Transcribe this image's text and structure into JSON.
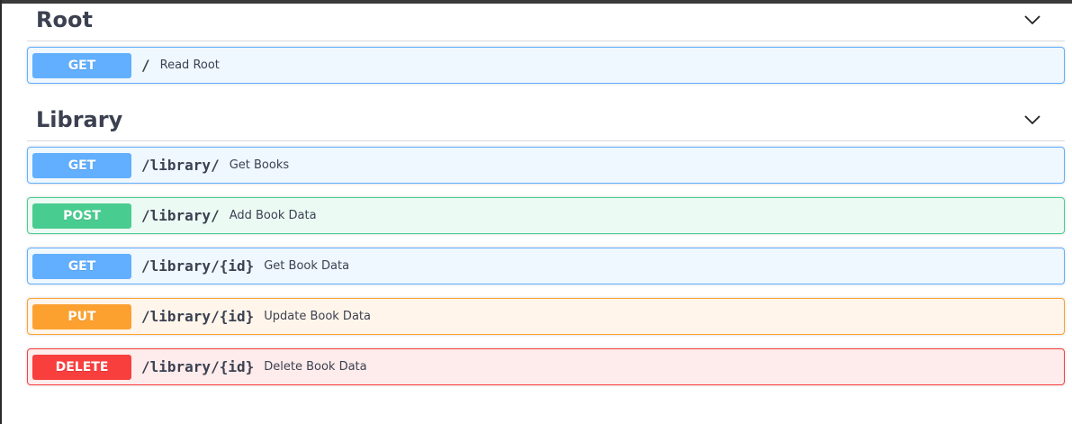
{
  "sections": [
    {
      "title": "Root",
      "operations": [
        {
          "method": "GET",
          "path": "/",
          "summary": "Read Root"
        }
      ]
    },
    {
      "title": "Library",
      "operations": [
        {
          "method": "GET",
          "path": "/library/",
          "summary": "Get Books"
        },
        {
          "method": "POST",
          "path": "/library/",
          "summary": "Add Book Data"
        },
        {
          "method": "GET",
          "path": "/library/{id}",
          "summary": "Get Book Data"
        },
        {
          "method": "PUT",
          "path": "/library/{id}",
          "summary": "Update Book Data"
        },
        {
          "method": "DELETE",
          "path": "/library/{id}",
          "summary": "Delete Book Data"
        }
      ]
    }
  ],
  "icons": {
    "collapse": "chevron-down-icon"
  },
  "colors": {
    "get": "#61affe",
    "post": "#49cc90",
    "put": "#fca130",
    "delete": "#f93e3e",
    "text": "#3b4151"
  }
}
